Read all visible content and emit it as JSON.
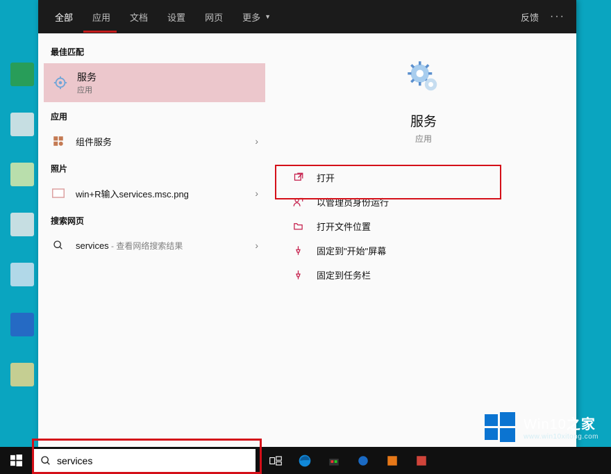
{
  "tabs": {
    "all": "全部",
    "apps": "应用",
    "docs": "文档",
    "settings": "设置",
    "web": "网页",
    "more": "更多",
    "feedback": "反馈"
  },
  "sections": {
    "best_match": "最佳匹配",
    "apps": "应用",
    "photos": "照片",
    "web": "搜索网页"
  },
  "best_match": {
    "title": "服务",
    "subtitle": "应用"
  },
  "app_row": {
    "label": "组件服务"
  },
  "photo_row": {
    "label": "win+R输入services.msc.png"
  },
  "web_row": {
    "query": "services",
    "suffix": " - 查看网络搜索结果"
  },
  "detail": {
    "title": "服务",
    "subtitle": "应用"
  },
  "actions": {
    "open": "打开",
    "run_as_admin": "以管理员身份运行",
    "open_location": "打开文件位置",
    "pin_start": "固定到\"开始\"屏幕",
    "pin_taskbar": "固定到任务栏"
  },
  "search": {
    "value": "services"
  },
  "watermark": {
    "main_a": "Win10",
    "main_b": "之家",
    "url": "www.win10xitong.com"
  },
  "colors": {
    "accent": "#c41c1c",
    "action_icon": "#c41c49"
  }
}
